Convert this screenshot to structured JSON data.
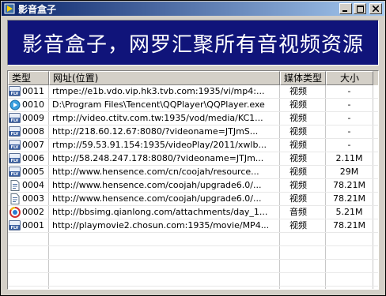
{
  "window": {
    "title": "影音盒子"
  },
  "window_controls": {
    "minimize": "_",
    "maximize": "□",
    "close": "×"
  },
  "banner": {
    "text": "影音盒子，网罗汇聚所有音视频资源"
  },
  "columns": [
    "类型",
    "网址(位置)",
    "媒体类型",
    "大小"
  ],
  "rows": [
    {
      "icon": "flv-file-icon",
      "id": "0011",
      "url": "rtmpe://e1b.vdo.vip.hk3.tvb.com:1935/vi/mp4:...",
      "media": "视频",
      "size": "-"
    },
    {
      "icon": "qqplayer-icon",
      "id": "0010",
      "url": "D:\\Program Files\\Tencent\\QQPlayer\\QQPlayer.exe",
      "media": "视频",
      "size": "-"
    },
    {
      "icon": "flv-file-icon",
      "id": "0009",
      "url": "rtmp://video.ctitv.com.tw:1935/vod/media/KC1...",
      "media": "视频",
      "size": "-"
    },
    {
      "icon": "flv-file-icon",
      "id": "0008",
      "url": "http://218.60.12.67:8080/?videoname=JTJmS...",
      "media": "视频",
      "size": "-"
    },
    {
      "icon": "flv-file-icon",
      "id": "0007",
      "url": "rtmp://59.53.91.154:1935/videoPlay/2011/xwlb...",
      "media": "视频",
      "size": "-"
    },
    {
      "icon": "flv-file-icon",
      "id": "0006",
      "url": "http://58.248.247.178:8080/?videoname=JTJm...",
      "media": "视频",
      "size": "2.11M"
    },
    {
      "icon": "flv-file-icon",
      "id": "0005",
      "url": "http://www.hensence.com/cn/coojah/resource...",
      "media": "视频",
      "size": "29M"
    },
    {
      "icon": "document-icon",
      "id": "0004",
      "url": "http://www.hensence.com/coojah/upgrade6.0/...",
      "media": "视频",
      "size": "78.21M"
    },
    {
      "icon": "document-icon",
      "id": "0003",
      "url": "http://www.hensence.com/coojah/upgrade6.0/...",
      "media": "视频",
      "size": "78.21M"
    },
    {
      "icon": "audio-player-icon",
      "id": "0002",
      "url": "http://bbsimg.qianlong.com/attachments/day_1...",
      "media": "音频",
      "size": "5.21M"
    },
    {
      "icon": "flv-file-icon",
      "id": "0001",
      "url": "http://playmovie2.chosun.com:1935/movie/MP4...",
      "media": "视频",
      "size": "78.21M"
    }
  ],
  "empty_rows": 5
}
